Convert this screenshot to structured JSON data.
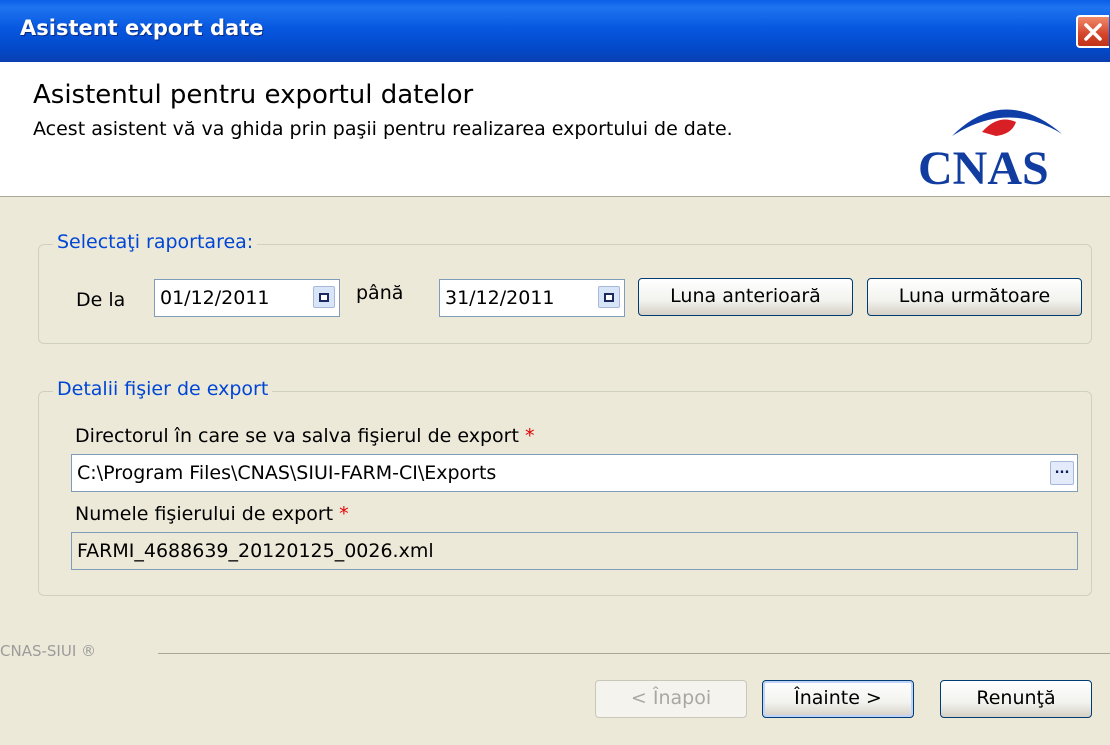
{
  "window": {
    "title": "Asistent export date"
  },
  "header": {
    "title": "Asistentul pentru exportul datelor",
    "subtitle": "Acest asistent vă va ghida prin paşii pentru realizarea exportului de date.",
    "logo_text": "CNAS"
  },
  "period": {
    "legend": "Selectaţi raportarea:",
    "from_label": "De la",
    "from_value": "01/12/2011",
    "to_label": "până",
    "to_value": "31/12/2011",
    "prev_month": "Luna anterioară",
    "next_month": "Luna următoare"
  },
  "file": {
    "legend": "Detalii fişier de export",
    "dir_label": "Directorul în care se va salva fişierul de export",
    "dir_value": "C:\\Program Files\\CNAS\\SIUI-FARM-CI\\Exports",
    "browse": "...",
    "name_label": "Numele fişierului de export",
    "name_value": "FARMI_4688639_20120125_0026.xml",
    "required_mark": "*"
  },
  "footer": {
    "brand": "CNAS-SIUI ®",
    "back": "< Înapoi",
    "next": "Înainte >",
    "cancel": "Renunţă"
  }
}
